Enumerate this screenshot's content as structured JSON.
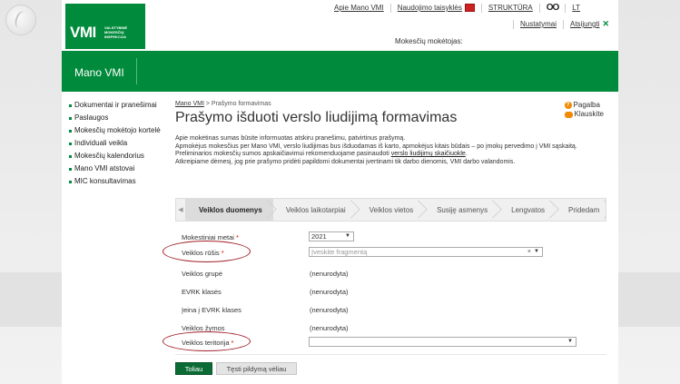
{
  "brand": {
    "logo_text": "VMI",
    "logo_sub": "VALSTYBINĖ MOKESČIŲ INSPEKCIJA",
    "accent": "#008a3b"
  },
  "header": {
    "links": [
      "Apie Mano VMI",
      "Naudojimo taisyklės",
      "STRUKTŪRA",
      "LT"
    ],
    "settings": "Nustatymai",
    "logout": "Atsijungti",
    "payer_label": "Mokesčių mokėtojas:"
  },
  "section_title": "Mano VMI",
  "sidebar": {
    "items": [
      {
        "label": "Dokumentai ir pranešimai"
      },
      {
        "label": "Paslaugos"
      },
      {
        "label": "Mokesčių mokėtojo kortelė"
      },
      {
        "label": "Individuali veikla"
      },
      {
        "label": "Mokesčių kalendorius"
      },
      {
        "label": "Mano VMI atstovai"
      },
      {
        "label": "MIC konsultavimas"
      }
    ]
  },
  "breadcrumb": {
    "home": "Mano VMI",
    "separator": " > ",
    "current": "Prašymo formavimas"
  },
  "page_title": "Prašymo išduoti verslo liudijimą formavimas",
  "help": {
    "help_label": "Pagalba",
    "ask_label": "Klauskite"
  },
  "intro": {
    "line1": "Apie mokėtinas sumas būsite informuotas atskiru pranešimu, patvirtinus prašymą.",
    "line2": "Apmokėjus mokesčius per Mano VMI, verslo liudijimas bus išduodamas iš karto, apmokėjus kitais būdais – po įmokų pervedimo į VMI sąskaitą.",
    "line3_pre": "Preliminarios mokesčių sumos apskaičiavimui rekomenduojame pasinaudoti ",
    "line3_link": "verslo liudijimų skaičiuokle",
    "line3_post": ".",
    "line4": "Atkreipiame dėmesį, jog prie prašymo pridėti papildomi dokumentai įvertinami tik darbo dienomis, VMI darbo valandomis."
  },
  "steps": [
    "Veiklos duomenys",
    "Veiklos laikotarpiai",
    "Veiklos vietos",
    "Susiję asmenys",
    "Lengvatos",
    "Pridedam"
  ],
  "form": {
    "year_label": "Mokestiniai metai",
    "year_value": "2021",
    "activity_type_label": "Veiklos rūšis",
    "activity_type_placeholder": "Įveskite fragmentą",
    "activity_group_label": "Veiklos grupė",
    "evrk_class_label": "EVRK klasės",
    "evrk_in_label": "Įeina į EVRK klases",
    "activity_marks_label": "Veiklos žymos",
    "not_specified": "(nenurodyta)",
    "territory_label": "Veiklos teritorija",
    "territory_value": ""
  },
  "buttons": {
    "next": "Toliau",
    "continue_later": "Tęsti pildymą vėliau"
  }
}
